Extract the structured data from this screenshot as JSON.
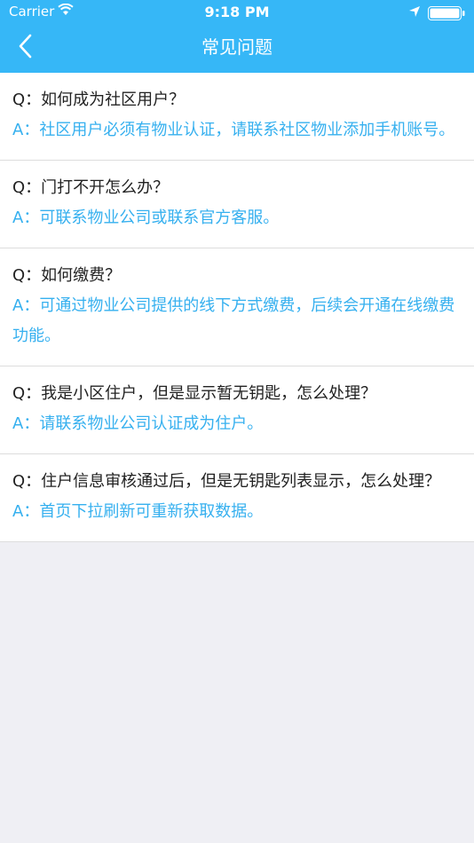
{
  "status_bar": {
    "carrier": "Carrier",
    "time": "9:18 PM"
  },
  "nav": {
    "title": "常见问题"
  },
  "faq": [
    {
      "q": "Q：如何成为社区用户？",
      "a": "A：社区用户必须有物业认证，请联系社区物业添加手机账号。"
    },
    {
      "q": "Q：门打不开怎么办？",
      "a": "A：可联系物业公司或联系官方客服。"
    },
    {
      "q": "Q：如何缴费？",
      "a": "A：可通过物业公司提供的线下方式缴费，后续会开通在线缴费功能。"
    },
    {
      "q": "Q：我是小区住户，但是显示暂无钥匙，怎么处理？",
      "a": "A：请联系物业公司认证成为住户。"
    },
    {
      "q": "Q：住户信息审核通过后，但是无钥匙列表显示，怎么处理？",
      "a": "A：首页下拉刷新可重新获取数据。"
    }
  ],
  "colors": {
    "header": "#36b7f7",
    "answer": "#36b0ef",
    "question": "#222222",
    "background": "#efeff4"
  },
  "icons": {
    "wifi": "wifi-icon",
    "location": "location-arrow-icon",
    "battery": "battery-icon",
    "back": "back-chevron-icon"
  }
}
